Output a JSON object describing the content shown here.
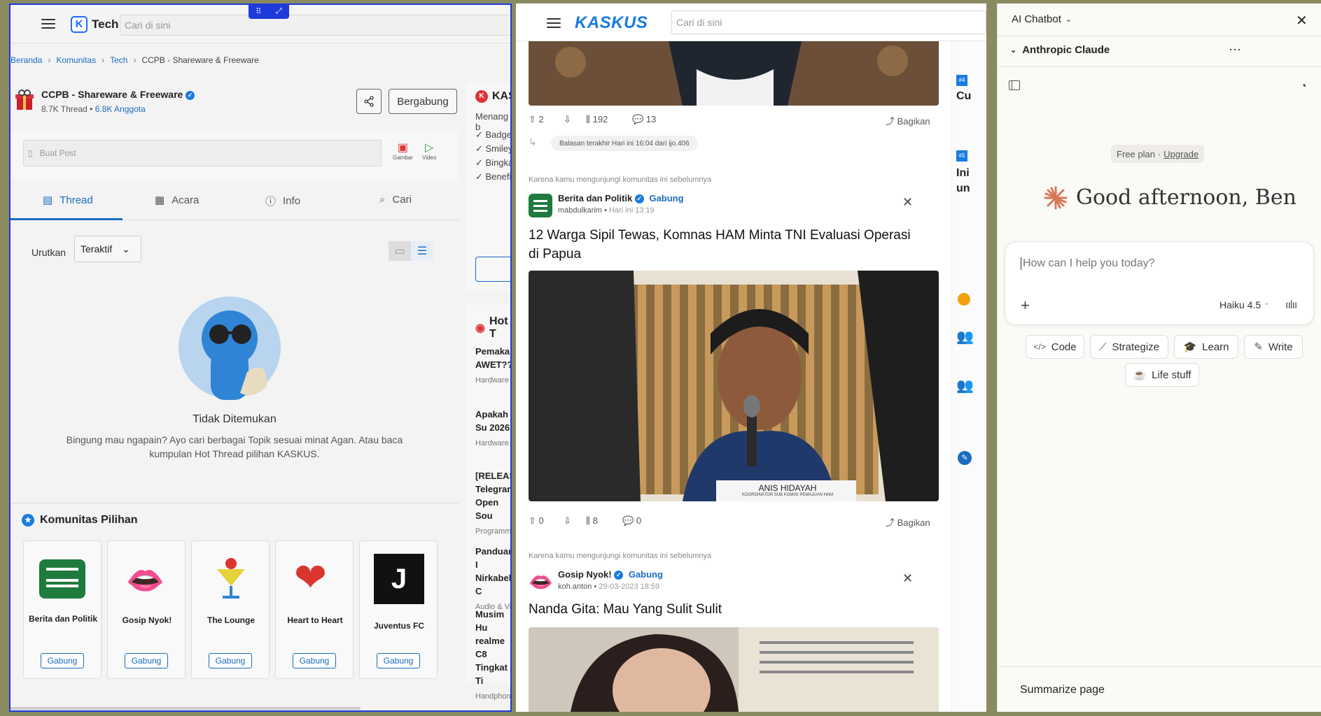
{
  "left": {
    "header": {
      "site_short": "Tech",
      "search_placeholder": "Cari di sini"
    },
    "breadcrumb": [
      "Beranda",
      "Komunitas",
      "Tech",
      "CCPB - Shareware & Freeware"
    ],
    "community": {
      "name": "CCPB - Shareware & Freeware",
      "threads": "8.7K Thread",
      "members": "6.8K Anggota",
      "join_label": "Bergabung"
    },
    "post_box": {
      "placeholder": "Buat Post",
      "image_label": "Gambar",
      "video_label": "Video"
    },
    "tabs": [
      "Thread",
      "Acara",
      "Info",
      "Cari"
    ],
    "sort": {
      "label": "Urutkan",
      "value": "Teraktif"
    },
    "empty": {
      "title": "Tidak Ditemukan",
      "desc": "Bingung mau ngapain? Ayo cari berbagai Topik sesuai minat Agan. Atau baca kumpulan Hot Thread pilihan KASKUS."
    },
    "featured": {
      "title": "Komunitas Pilihan",
      "items": [
        {
          "name": "Berita dan Politik",
          "join": "Gabung"
        },
        {
          "name": "Gosip Nyok!",
          "join": "Gabung"
        },
        {
          "name": "The Lounge",
          "join": "Gabung"
        },
        {
          "name": "Heart to Heart",
          "join": "Gabung"
        },
        {
          "name": "Juventus FC",
          "join": "Gabung"
        }
      ]
    },
    "side_kaskus": {
      "title": "KASI",
      "sub": "Menang b",
      "benefits": [
        "Badge",
        "Smiley",
        "Bingka",
        "Benefi"
      ]
    },
    "hot": {
      "title": "Hot T",
      "items": [
        {
          "title": "Pemakaia AWET???",
          "cat": "Hardware C"
        },
        {
          "title": "Apakah Su 2026?",
          "cat": "Hardware C"
        },
        {
          "title": "[RELEASE Telegram Open Sou",
          "cat": "Programme"
        },
        {
          "title": "Panduan I Nirkabel: C",
          "cat": "Audio & Vid"
        },
        {
          "title": "Musim Hu realme C8 Tingkat Ti",
          "cat": "Handphone"
        }
      ]
    }
  },
  "middle": {
    "header": {
      "logo": "KASKUS",
      "search_placeholder": "Cari di sini"
    },
    "post0": {
      "up": "2",
      "views": "192",
      "comments": "13",
      "share": "Bagikan",
      "last_reply": "Balasan terakhir Hari ini 16:04 dari ijo.406"
    },
    "post1": {
      "reason": "Karena kamu mengunjungi komunitas ini sebelumnya",
      "community": "Berita dan Politik",
      "join": "Gabung",
      "author": "mabdulkarim",
      "time": "Hari ini 13:19",
      "title": "12 Warga Sipil Tewas, Komnas HAM Minta TNI Evaluasi Operasi di Papua",
      "name_plate": "ANIS HIDAYAH",
      "name_plate_sub": "KOORDINATOR SUB KOMISI PEMAJUAN HAM",
      "up": "0",
      "views": "8",
      "comments": "0",
      "share": "Bagikan"
    },
    "post2": {
      "reason": "Karena kamu mengunjungi komunitas ini sebelumnya",
      "community": "Gosip Nyok!",
      "join": "Gabung",
      "author": "koh.anton",
      "time": "29-03-2023 18:59",
      "title": "Nanda Gita: Mau Yang Sulit Sulit"
    },
    "right_strip": {
      "rank4": "#4",
      "rank4_text": "Cu",
      "rank5": "#5",
      "rank5_text": "Ini un"
    }
  },
  "chat": {
    "header": "AI Chatbot",
    "model_group": "Anthropic Claude",
    "plan": "Free plan",
    "upgrade": "Upgrade",
    "greeting": "Good afternoon, Ben",
    "input_placeholder": "How can I help you today?",
    "model": "Haiku 4.5",
    "chips": [
      "Code",
      "Strategize",
      "Learn",
      "Write",
      "Life stuff"
    ],
    "summarize": "Summarize page"
  },
  "colors": {
    "accent": "#1a6cc0",
    "kaskus_blue": "#1a7be0",
    "kaskus_orange": "#ff6b00",
    "claude": "#d97757"
  }
}
